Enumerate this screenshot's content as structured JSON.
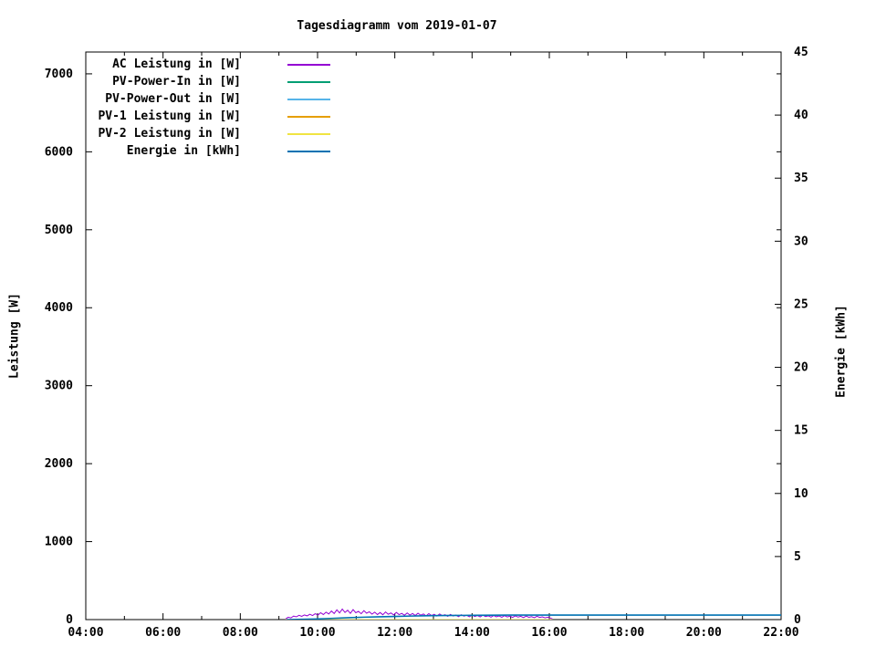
{
  "chart_data": {
    "type": "line",
    "title": "Tagesdiagramm vom 2019-01-07",
    "background_color": "#ffffff",
    "axis_color": "#000000",
    "grid": false,
    "legend_position": "top-left-inside",
    "x_axis": {
      "min": 4,
      "max": 22,
      "minor_tick_step": 1,
      "ticks": [
        {
          "v": 4,
          "label": "04:00"
        },
        {
          "v": 6,
          "label": "06:00"
        },
        {
          "v": 8,
          "label": "08:00"
        },
        {
          "v": 10,
          "label": "10:00"
        },
        {
          "v": 12,
          "label": "12:00"
        },
        {
          "v": 14,
          "label": "14:00"
        },
        {
          "v": 16,
          "label": "16:00"
        },
        {
          "v": 18,
          "label": "18:00"
        },
        {
          "v": 20,
          "label": "20:00"
        },
        {
          "v": 22,
          "label": "22:00"
        }
      ]
    },
    "y_left": {
      "label": "Leistung [W]",
      "min": 0,
      "max": 7280,
      "ticks": [
        {
          "v": 0,
          "label": "0"
        },
        {
          "v": 1000,
          "label": "1000"
        },
        {
          "v": 2000,
          "label": "2000"
        },
        {
          "v": 3000,
          "label": "3000"
        },
        {
          "v": 4000,
          "label": "4000"
        },
        {
          "v": 5000,
          "label": "5000"
        },
        {
          "v": 6000,
          "label": "6000"
        },
        {
          "v": 7000,
          "label": "7000"
        }
      ]
    },
    "y_right": {
      "label": "Energie [kWh]",
      "min": 0,
      "max": 45,
      "ticks": [
        {
          "v": 0,
          "label": "0"
        },
        {
          "v": 5,
          "label": "5"
        },
        {
          "v": 10,
          "label": "10"
        },
        {
          "v": 15,
          "label": "15"
        },
        {
          "v": 20,
          "label": "20"
        },
        {
          "v": 25,
          "label": "25"
        },
        {
          "v": 30,
          "label": "30"
        },
        {
          "v": 35,
          "label": "35"
        },
        {
          "v": 40,
          "label": "40"
        },
        {
          "v": 45,
          "label": "45"
        }
      ]
    },
    "series": [
      {
        "name": "AC Leistung in [W]",
        "color": "#9400d3",
        "axis": "left",
        "width": 1,
        "points": [
          [
            9.17,
            8
          ],
          [
            9.24,
            30
          ],
          [
            9.31,
            22
          ],
          [
            9.38,
            45
          ],
          [
            9.45,
            35
          ],
          [
            9.52,
            55
          ],
          [
            9.59,
            42
          ],
          [
            9.66,
            60
          ],
          [
            9.73,
            48
          ],
          [
            9.8,
            68
          ],
          [
            9.87,
            52
          ],
          [
            9.94,
            75
          ],
          [
            10.01,
            58
          ],
          [
            10.08,
            88
          ],
          [
            10.15,
            65
          ],
          [
            10.22,
            95
          ],
          [
            10.29,
            72
          ],
          [
            10.36,
            110
          ],
          [
            10.43,
            78
          ],
          [
            10.5,
            125
          ],
          [
            10.57,
            85
          ],
          [
            10.64,
            135
          ],
          [
            10.71,
            92
          ],
          [
            10.78,
            120
          ],
          [
            10.85,
            80
          ],
          [
            10.92,
            128
          ],
          [
            10.99,
            88
          ],
          [
            11.06,
            105
          ],
          [
            11.13,
            75
          ],
          [
            11.2,
            115
          ],
          [
            11.27,
            82
          ],
          [
            11.34,
            100
          ],
          [
            11.41,
            70
          ],
          [
            11.48,
            95
          ],
          [
            11.55,
            65
          ],
          [
            11.62,
            90
          ],
          [
            11.69,
            62
          ],
          [
            11.76,
            98
          ],
          [
            11.83,
            68
          ],
          [
            11.9,
            85
          ],
          [
            11.97,
            60
          ],
          [
            12.04,
            92
          ],
          [
            12.11,
            64
          ],
          [
            12.18,
            80
          ],
          [
            12.25,
            55
          ],
          [
            12.32,
            85
          ],
          [
            12.39,
            58
          ],
          [
            12.46,
            78
          ],
          [
            12.53,
            52
          ],
          [
            12.6,
            82
          ],
          [
            12.67,
            56
          ],
          [
            12.74,
            72
          ],
          [
            12.81,
            48
          ],
          [
            12.88,
            76
          ],
          [
            12.95,
            52
          ],
          [
            13.02,
            68
          ],
          [
            13.09,
            45
          ],
          [
            13.16,
            72
          ],
          [
            13.23,
            50
          ],
          [
            13.3,
            62
          ],
          [
            13.37,
            42
          ],
          [
            13.44,
            66
          ],
          [
            13.51,
            46
          ],
          [
            13.58,
            58
          ],
          [
            13.65,
            38
          ],
          [
            13.72,
            62
          ],
          [
            13.79,
            44
          ],
          [
            13.86,
            55
          ],
          [
            13.93,
            36
          ],
          [
            14.0,
            58
          ],
          [
            14.07,
            40
          ],
          [
            14.14,
            52
          ],
          [
            14.21,
            34
          ],
          [
            14.28,
            56
          ],
          [
            14.35,
            38
          ],
          [
            14.42,
            48
          ],
          [
            14.49,
            32
          ],
          [
            14.56,
            52
          ],
          [
            14.63,
            36
          ],
          [
            14.7,
            46
          ],
          [
            14.77,
            30
          ],
          [
            14.84,
            50
          ],
          [
            14.91,
            34
          ],
          [
            14.98,
            44
          ],
          [
            15.05,
            28
          ],
          [
            15.12,
            48
          ],
          [
            15.19,
            32
          ],
          [
            15.26,
            42
          ],
          [
            15.33,
            26
          ],
          [
            15.4,
            45
          ],
          [
            15.47,
            30
          ],
          [
            15.54,
            38
          ],
          [
            15.61,
            24
          ],
          [
            15.68,
            42
          ],
          [
            15.75,
            28
          ],
          [
            15.82,
            35
          ],
          [
            15.89,
            22
          ],
          [
            15.96,
            30
          ],
          [
            16.03,
            18
          ],
          [
            16.08,
            10
          ]
        ]
      },
      {
        "name": "PV-Power-In in [W]",
        "color": "#009e73",
        "axis": "left",
        "width": 1,
        "points": [
          [
            9.17,
            0
          ],
          [
            16.08,
            0
          ]
        ]
      },
      {
        "name": "PV-Power-Out in [W]",
        "color": "#56b4e9",
        "axis": "left",
        "width": 1,
        "points": [
          [
            9.17,
            0
          ],
          [
            16.08,
            0
          ]
        ]
      },
      {
        "name": "PV-1 Leistung in [W]",
        "color": "#e69f00",
        "axis": "left",
        "width": 1,
        "points": [
          [
            9.17,
            0
          ],
          [
            16.08,
            0
          ]
        ]
      },
      {
        "name": "PV-2 Leistung in [W]",
        "color": "#f0e442",
        "axis": "left",
        "width": 1,
        "points": [
          [
            9.17,
            0
          ],
          [
            16.08,
            0
          ]
        ]
      },
      {
        "name": "Energie in [kWh]",
        "color": "#0072b2",
        "axis": "right",
        "width": 1.6,
        "points": [
          [
            9.2,
            0
          ],
          [
            9.6,
            0.02
          ],
          [
            10.0,
            0.05
          ],
          [
            10.4,
            0.1
          ],
          [
            10.8,
            0.15
          ],
          [
            11.2,
            0.19
          ],
          [
            11.6,
            0.22
          ],
          [
            12.0,
            0.25
          ],
          [
            12.4,
            0.28
          ],
          [
            12.8,
            0.3
          ],
          [
            13.2,
            0.32
          ],
          [
            13.6,
            0.33
          ],
          [
            14.0,
            0.34
          ],
          [
            14.5,
            0.35
          ],
          [
            15.0,
            0.355
          ],
          [
            15.5,
            0.36
          ],
          [
            16.08,
            0.36
          ],
          [
            22.0,
            0.36
          ]
        ]
      }
    ]
  }
}
